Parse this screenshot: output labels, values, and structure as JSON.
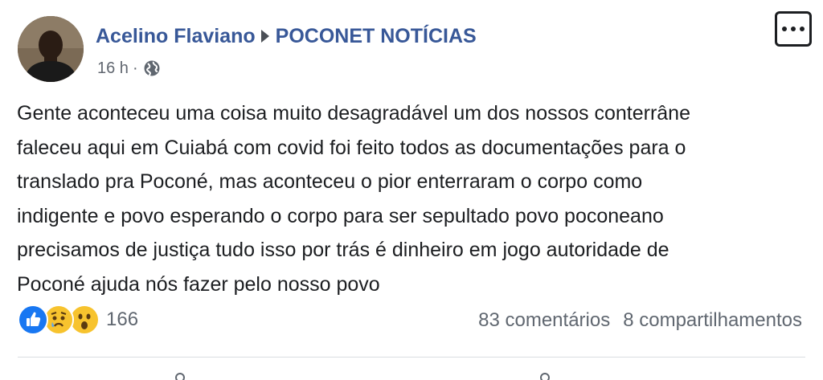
{
  "header": {
    "author": "Acelino Flaviano",
    "group": "POCONET NOTÍCIAS",
    "time": "16 h",
    "separator": "·"
  },
  "post": {
    "lines": [
      "Gente aconteceu uma coisa muito desagradável um dos nossos conterrâne",
      "faleceu aqui em Cuiabá com covid foi feito todos as documentações para o",
      "translado pra Poconé, mas aconteceu o pior enterraram o corpo como",
      "indigente e povo esperando o corpo para ser sepultado povo poconeano",
      "precisamos de justiça tudo isso por trás é dinheiro em jogo autoridade de",
      "Poconé ajuda nós fazer pelo nosso povo"
    ]
  },
  "reactions": {
    "icons": [
      "like-icon",
      "sad-icon",
      "wow-icon"
    ],
    "count": "166"
  },
  "stats": {
    "comments": "83 comentários",
    "shares": "8 compartilhamentos"
  },
  "colors": {
    "name_link": "#385898",
    "text": "#1c1e21",
    "muted": "#606770",
    "like_blue": "#1877f2",
    "emoji_yellow": "#f7c32e"
  }
}
